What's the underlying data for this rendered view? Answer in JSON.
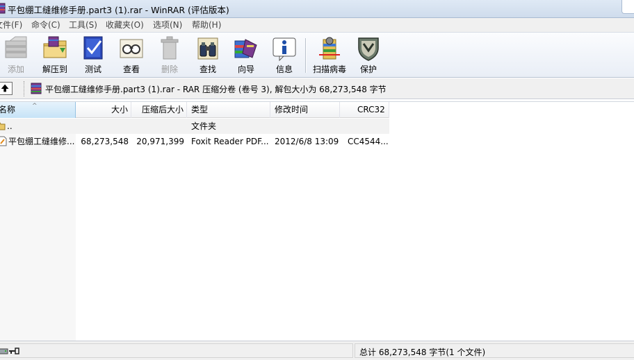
{
  "window": {
    "title": "平包绷工缝维修手册.part3 (1).rar - WinRAR (评估版本)"
  },
  "menu": {
    "items": [
      {
        "label": "文件(F)"
      },
      {
        "label": "命令(C)"
      },
      {
        "label": "工具(S)"
      },
      {
        "label": "收藏夹(O)"
      },
      {
        "label": "选项(N)"
      },
      {
        "label": "帮助(H)"
      }
    ]
  },
  "toolbar": {
    "buttons": [
      {
        "label": "添加",
        "icon": "add-archive-icon",
        "enabled": false
      },
      {
        "label": "解压到",
        "icon": "extract-folder-icon",
        "enabled": true
      },
      {
        "label": "测试",
        "icon": "test-archive-icon",
        "enabled": true
      },
      {
        "label": "查看",
        "icon": "view-glasses-icon",
        "enabled": true
      },
      {
        "label": "删除",
        "icon": "delete-trash-icon",
        "enabled": false
      },
      {
        "label": "查找",
        "icon": "find-binoculars-icon",
        "enabled": true
      },
      {
        "label": "向导",
        "icon": "wizard-icon",
        "enabled": true
      },
      {
        "label": "信息",
        "icon": "info-icon",
        "enabled": true
      },
      {
        "label": "扫描病毒",
        "icon": "virus-scan-icon",
        "enabled": true
      },
      {
        "label": "保护",
        "icon": "protect-shield-icon",
        "enabled": true
      }
    ]
  },
  "address": {
    "text": "平包绷工缝维修手册.part3 (1).rar - RAR 压缩分卷 (卷号 3), 解包大小为 68,273,548 字节"
  },
  "list": {
    "columns": [
      {
        "label": "名称",
        "sorted": true
      },
      {
        "label": "大小"
      },
      {
        "label": "压缩后大小"
      },
      {
        "label": "类型"
      },
      {
        "label": "修改时间"
      },
      {
        "label": "CRC32"
      }
    ],
    "parent_row": {
      "name": "..",
      "type": "文件夹"
    },
    "rows": [
      {
        "name": "平包绷工缝维修...",
        "size": "68,273,548",
        "packed": "20,971,399",
        "type": "Foxit Reader PDF...",
        "modified": "2012/6/8 13:09",
        "crc": "CC4544..."
      }
    ]
  },
  "status": {
    "summary": "总计 68,273,548 字节(1 个文件)"
  },
  "colors": {
    "titlebar": "#dfe9f5",
    "selected_header": "#c6e3f7",
    "toolbar_bg": "#eef2f8"
  }
}
